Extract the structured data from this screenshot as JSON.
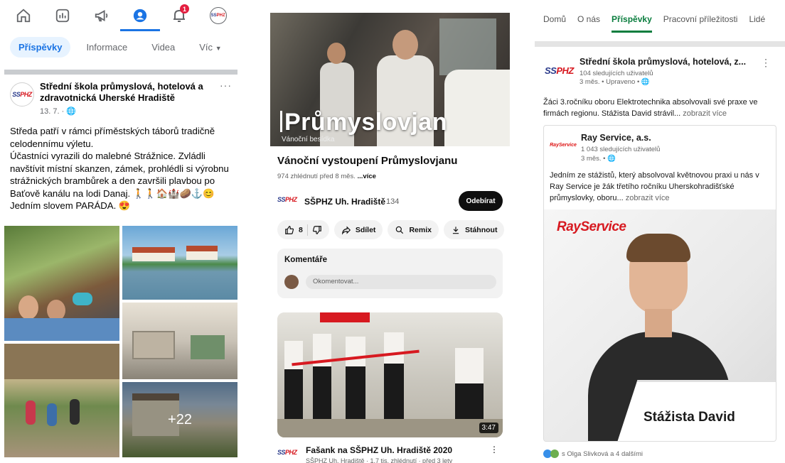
{
  "facebook": {
    "tabs": [
      "home",
      "dashboard",
      "megaphone",
      "profile",
      "notifications",
      "page-avatar"
    ],
    "notification_badge": "1",
    "subtabs": [
      {
        "label": "Příspěvky",
        "active": true
      },
      {
        "label": "Informace",
        "active": false
      },
      {
        "label": "Videa",
        "active": false
      },
      {
        "label": "Víc",
        "active": false
      }
    ],
    "post": {
      "page_name": "Střední škola průmyslová, hotelová a zdravotnická Uherské Hradiště",
      "date": "13. 7. · ",
      "more": "···",
      "paragraphs": [
        "Středa patří v rámci příměstských táborů tradičně celodennímu výletu.",
        "Účastníci vyrazili do malebné Strážnice. Zvládli navštívit místní skanzen, zámek, prohlédli si výrobnu strážnických brambůrek a den završili plavbou po Baťově kanálu na lodi Danaj. 🚶🚶🏠🏰🥔⚓😊",
        "Jedním slovem PARÁDA. 😍"
      ],
      "more_photos": "+22"
    },
    "colors": {
      "accent": "#1b74e4",
      "badge": "#e41e3f"
    }
  },
  "youtube": {
    "hero_title": "Průmyslovjan",
    "hero_subtitle": "Vánoční besídka",
    "video_title": "Vánoční vystoupení Průmyslovjanu",
    "video_meta": "974 zhlédnutí  před 8 měs.",
    "video_meta_more": "...více",
    "channel_name": "SŠPHZ Uh. Hradiště",
    "channel_subs": "134",
    "subscribe_label": "Odebírat",
    "actions": {
      "likes": "8",
      "share": "Sdílet",
      "remix": "Remix",
      "download": "Stáhnout"
    },
    "comments_title": "Komentáře",
    "comment_placeholder": "Okomentovat...",
    "video2": {
      "duration": "3:47",
      "title": "Fašank na SŠPHZ Uh. Hradiště 2020",
      "meta": "SŠPHZ Uh. Hradiště · 1,7 tis. zhlédnutí · před 3 lety",
      "more": "⋮"
    },
    "colors": {
      "subscribe_bg": "#0f0f0f"
    }
  },
  "linkedin": {
    "tabs": [
      {
        "label": "Domů",
        "active": false
      },
      {
        "label": "O nás",
        "active": false
      },
      {
        "label": "Příspěvky",
        "active": true
      },
      {
        "label": "Pracovní příležitosti",
        "active": false
      },
      {
        "label": "Lidé",
        "active": false
      }
    ],
    "post": {
      "company": "Střední škola průmyslová, hotelová, z...",
      "followers": "104 sledujících uživatelů",
      "time": "3 měs. • Upraveno • ",
      "text": "Žáci 3.ročníku oboru Elektrotechnika absolvovali své praxe ve firmách regionu. Stážista David strávil...",
      "more": " zobrazit více",
      "dots": "⋮"
    },
    "shared": {
      "logo_text": "RayService",
      "company": "Ray Service, a.s.",
      "followers": "1 043 sledujících uživatelů",
      "time": "3 měs. • ",
      "text": "Jedním ze stážistů, který absolvoval květnovou praxi u nás v Ray Service je žák třetího ročníku Uherskohradišťské průmyslovky, oboru...",
      "more": " zobrazit více",
      "image_logo": "RayService",
      "image_caption": "Stážista David"
    },
    "reactions": "s Olga Slivková a 4 dalšími",
    "colors": {
      "accent": "#0a7d3e"
    }
  },
  "logo": {
    "ss": "SS",
    "phz": "PHZ"
  }
}
